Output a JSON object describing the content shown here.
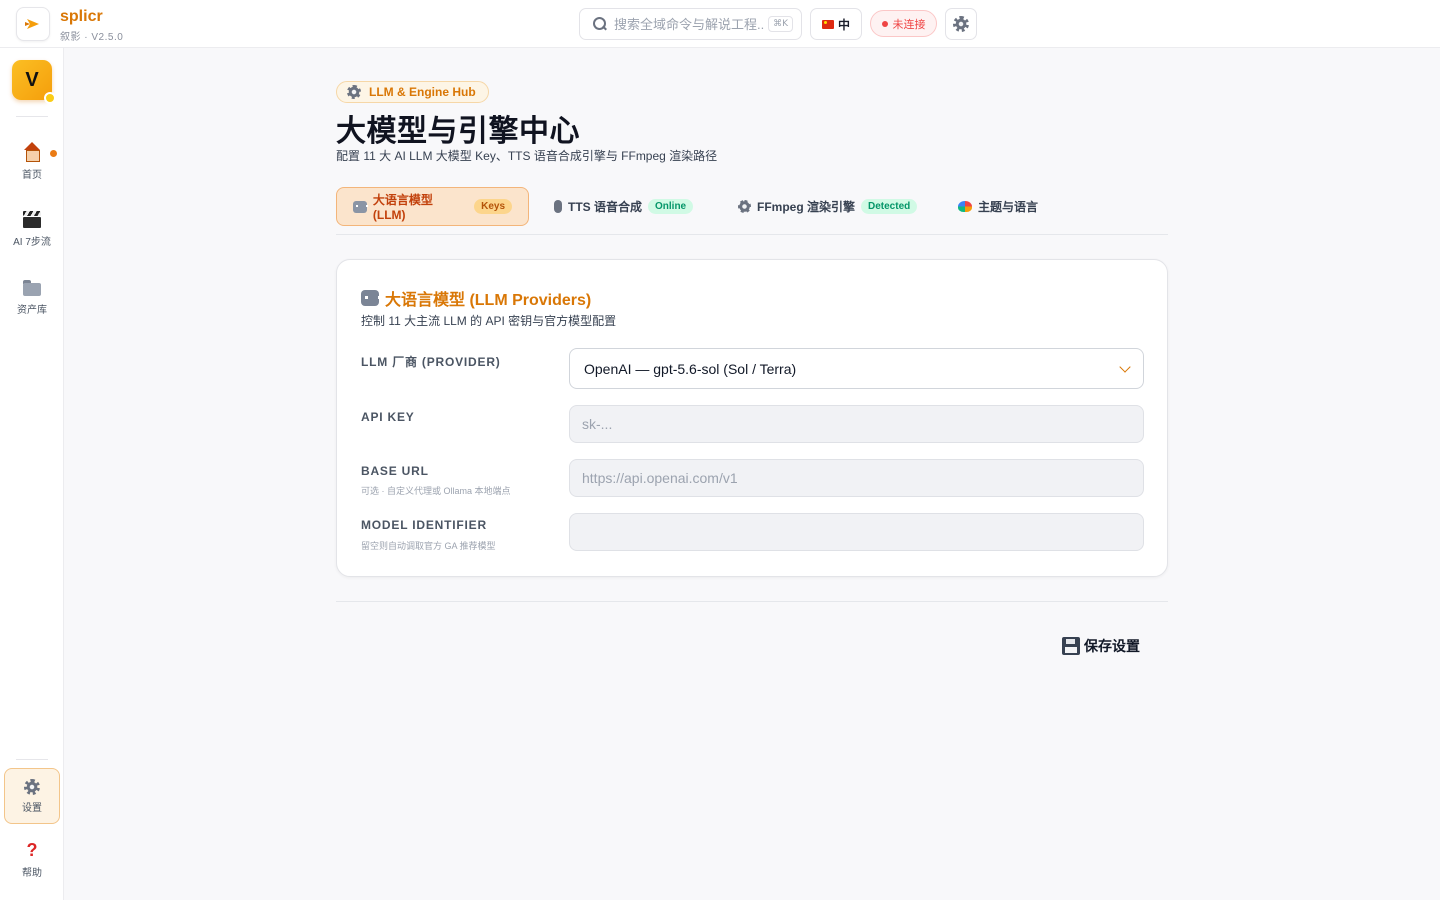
{
  "app": {
    "name": "splicr",
    "subtitle": "叙影 · V2.5.0"
  },
  "topbar": {
    "search_placeholder": "搜索全域命令与解说工程...",
    "search_shortcut": "⌘K",
    "language": "中",
    "status": "未连接"
  },
  "sidebar": {
    "avatar": "V",
    "items": [
      {
        "label": "首页",
        "icon": "house-icon"
      },
      {
        "label": "AI 7步流",
        "icon": "clapper-icon"
      },
      {
        "label": "资产库",
        "icon": "folder-icon"
      }
    ],
    "bottom": [
      {
        "label": "设置",
        "icon": "gear-icon"
      },
      {
        "label": "帮助",
        "icon": "question-icon"
      }
    ]
  },
  "page": {
    "chip": "LLM & Engine Hub",
    "title": "大模型与引擎中心",
    "description": "配置 11 大 AI LLM 大模型 Key、TTS 语音合成引擎与 FFmpeg 渲染路径"
  },
  "tabs": [
    {
      "label": "大语言模型 (LLM)",
      "badge": "Keys"
    },
    {
      "label": "TTS 语音合成",
      "badge": "Online"
    },
    {
      "label": "FFmpeg 渲染引擎",
      "badge": "Detected"
    },
    {
      "label": "主题与语言",
      "badge": ""
    }
  ],
  "card": {
    "title": "大语言模型 (LLM Providers)",
    "description": "控制 11 大主流 LLM 的 API 密钥与官方模型配置",
    "fields": {
      "provider": {
        "label": "LLM 厂商 (PROVIDER)",
        "value": "OpenAI — gpt-5.6-sol (Sol / Terra)"
      },
      "api_key": {
        "label": "API KEY",
        "placeholder": "sk-...",
        "value": ""
      },
      "base_url": {
        "label": "BASE URL",
        "hint": "可选 · 自定义代理或 Ollama 本地端点",
        "placeholder": "https://api.openai.com/v1",
        "value": ""
      },
      "model_id": {
        "label": "MODEL IDENTIFIER",
        "hint": "留空则自动调取官方 GA 推荐模型",
        "placeholder": "",
        "value": ""
      }
    }
  },
  "actions": {
    "save": "保存设置"
  },
  "colors": {
    "accent": "#d97706",
    "status_error": "#ef4444",
    "success": "#059669"
  }
}
